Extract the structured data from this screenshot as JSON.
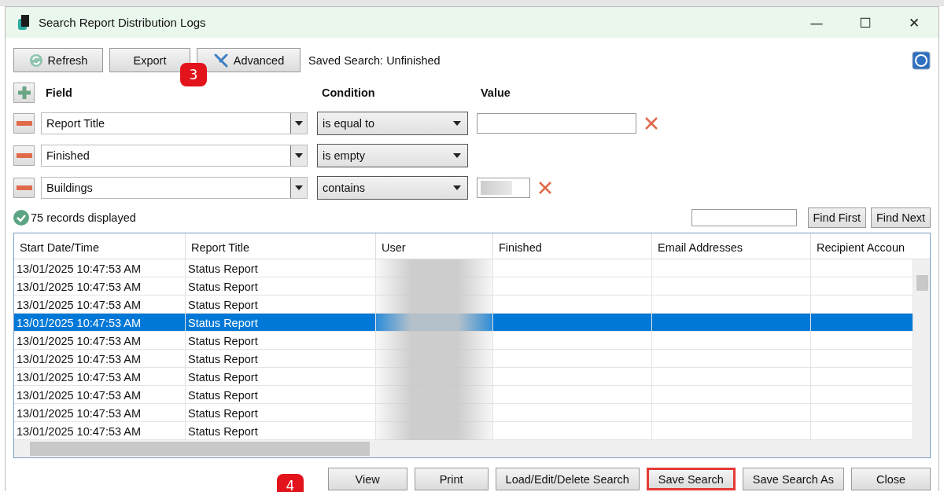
{
  "window": {
    "title": "Search Report Distribution Logs",
    "controls": [
      "—",
      "☐",
      "✕"
    ]
  },
  "toolbar": {
    "buttons": [
      {
        "label": "Refresh",
        "kind": "refresh"
      },
      {
        "label": "Export",
        "kind": "plain"
      },
      {
        "label": "Advanced",
        "kind": "tools"
      }
    ],
    "saved_search": "Saved Search: Unfinished",
    "badge": "3"
  },
  "criteria": {
    "headers": [
      "Field",
      "Condition",
      "Value"
    ],
    "rows": [
      {
        "field": "Report Title",
        "condition": "is equal to",
        "kind": "text"
      },
      {
        "field": "Finished",
        "condition": "is empty",
        "kind": "none"
      },
      {
        "field": "Buildings",
        "condition": "contains",
        "kind": "short"
      }
    ]
  },
  "status": "75 records displayed",
  "find": {
    "buttons": [
      "Find First",
      "Find Next"
    ]
  },
  "table": {
    "columns": [
      "Start Date/Time",
      "Report Title",
      "User",
      "Finished",
      "Email Addresses",
      "Recipient Accoun"
    ],
    "rows": [
      {
        "start": "13/01/2025 10:47:53 AM",
        "title": "Status Report",
        "selected": false
      },
      {
        "start": "13/01/2025 10:47:53 AM",
        "title": "Status Report",
        "selected": false
      },
      {
        "start": "13/01/2025 10:47:53 AM",
        "title": "Status Report",
        "selected": false
      },
      {
        "start": "13/01/2025 10:47:53 AM",
        "title": "Status Report",
        "selected": true
      },
      {
        "start": "13/01/2025 10:47:53 AM",
        "title": "Status Report",
        "selected": false
      },
      {
        "start": "13/01/2025 10:47:53 AM",
        "title": "Status Report",
        "selected": false
      },
      {
        "start": "13/01/2025 10:47:53 AM",
        "title": "Status Report",
        "selected": false
      },
      {
        "start": "13/01/2025 10:47:53 AM",
        "title": "Status Report",
        "selected": false
      },
      {
        "start": "13/01/2025 10:47:53 AM",
        "title": "Status Report",
        "selected": false
      },
      {
        "start": "13/01/2025 10:47:53 AM",
        "title": "Status Report",
        "selected": false
      }
    ]
  },
  "footer": {
    "badge": "4",
    "buttons": [
      {
        "label": "View",
        "highlighted": false
      },
      {
        "label": "Print",
        "highlighted": false
      },
      {
        "label": "Load/Edit/Delete Search",
        "highlighted": false
      },
      {
        "label": "Save Search",
        "highlighted": true
      },
      {
        "label": "Save Search As",
        "highlighted": false
      },
      {
        "label": "Close",
        "highlighted": false
      }
    ]
  }
}
